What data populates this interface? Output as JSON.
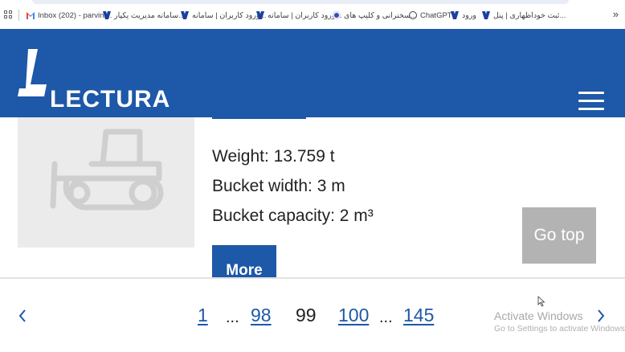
{
  "bookmarks": {
    "items": [
      {
        "label": "Inbox (202) - parvini...",
        "icon": "gmail-icon"
      },
      {
        "label": "سامانه مدیریت یکپار...",
        "icon": "university-icon"
      },
      {
        "label": "ورود کاربران | سامانه...",
        "icon": "university-icon"
      },
      {
        "label": "ورود کاربران | سامانه...",
        "icon": "university-icon"
      },
      {
        "label": "سخنرانی و کلیپ های...",
        "icon": "sphere-icon"
      },
      {
        "label": "ChatGPT",
        "icon": "chatgpt-icon"
      },
      {
        "label": "ورود",
        "icon": "university-icon"
      },
      {
        "label": "ثبت خوداظهاری | پنل...",
        "icon": "university-icon"
      }
    ],
    "overflow_label": "»"
  },
  "header": {
    "brand": "LECTURA",
    "background": "#1e58a8"
  },
  "product": {
    "specs": {
      "weight": "Weight: 13.759 t",
      "bucket_width": "Bucket width: 3 m",
      "bucket_capacity": "Bucket capacity: 2 m³"
    },
    "more_label": "More",
    "image_icon": "bulldozer-icon"
  },
  "go_top_label": "Go top",
  "pagination": {
    "first": "1",
    "ellipsis": "...",
    "prev_page": "98",
    "current": "99",
    "next_page": "100",
    "last": "145",
    "prev_icon": "chevron-left-icon",
    "next_icon": "chevron-right-icon"
  },
  "os_watermark": {
    "title": "Activate Windows",
    "subtitle": "Go to Settings to activate Windows."
  }
}
